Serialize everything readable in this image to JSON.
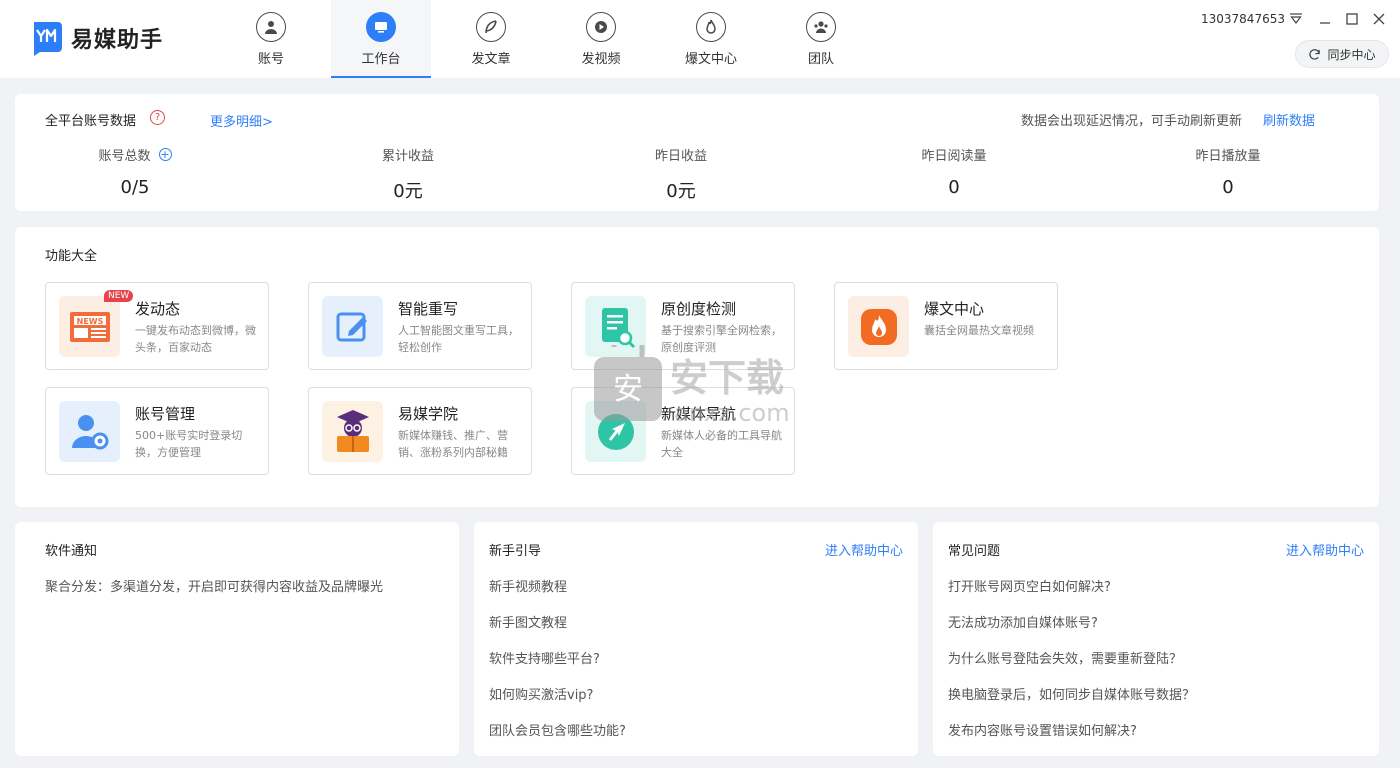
{
  "app": {
    "title": "易媒助手",
    "phone": "13037847653",
    "sync_label": "同步中心"
  },
  "nav": [
    {
      "label": "账号",
      "icon": "user-icon",
      "active": false
    },
    {
      "label": "工作台",
      "icon": "monitor-icon",
      "active": true
    },
    {
      "label": "发文章",
      "icon": "feather-icon",
      "active": false
    },
    {
      "label": "发视频",
      "icon": "play-icon",
      "active": false
    },
    {
      "label": "爆文中心",
      "icon": "fire-icon",
      "active": false
    },
    {
      "label": "团队",
      "icon": "team-icon",
      "active": false
    }
  ],
  "stats": {
    "title": "全平台账号数据",
    "more": "更多明细>",
    "delay_note": "数据会出现延迟情况，可手动刷新更新",
    "refresh": "刷新数据",
    "items": [
      {
        "label": "账号总数",
        "value": "0/5"
      },
      {
        "label": "累计收益",
        "value": "0元"
      },
      {
        "label": "昨日收益",
        "value": "0元"
      },
      {
        "label": "昨日阅读量",
        "value": "0"
      },
      {
        "label": "昨日播放量",
        "value": "0"
      }
    ]
  },
  "features": {
    "title": "功能大全",
    "badge": "NEW",
    "icon_text": "NEWS",
    "items": [
      {
        "name": "发动态",
        "desc": "一键发布动态到微博，微头条，百家动态",
        "icon": "news-icon",
        "color": "#fdeee4"
      },
      {
        "name": "智能重写",
        "desc": "人工智能图文重写工具，轻松创作",
        "icon": "edit-icon",
        "color": "#e6f0fd"
      },
      {
        "name": "原创度检测",
        "desc": "基于搜索引擎全网检索，原创度评测",
        "icon": "document-search-icon",
        "color": "#e2f6f3"
      },
      {
        "name": "爆文中心",
        "desc": "囊括全网最热文章视频",
        "icon": "fire-icon",
        "color": "#fdeee4"
      },
      {
        "name": "账号管理",
        "desc": "500+账号实时登录切换，方便管理",
        "icon": "account-settings-icon",
        "color": "#e6f0fd"
      },
      {
        "name": "易媒学院",
        "desc": "新媒体赚钱、推广、营销、涨粉系列内部秘籍",
        "icon": "scholar-icon",
        "color": "#fdf1e4"
      },
      {
        "name": "新媒体导航",
        "desc": "新媒体人必备的工具导航大全",
        "icon": "navigation-icon",
        "color": "#e2f6f3"
      }
    ]
  },
  "notice": {
    "title": "软件通知",
    "text": "聚合分发：多渠道分发，开启即可获得内容收益及品牌曝光"
  },
  "guide": {
    "title": "新手引导",
    "link": "进入帮助中心",
    "items": [
      "新手视频教程",
      "新手图文教程",
      "软件支持哪些平台?",
      "如何购买激活vip?",
      "团队会员包含哪些功能?"
    ]
  },
  "faq": {
    "title": "常见问题",
    "link": "进入帮助中心",
    "items": [
      "打开账号网页空白如何解决?",
      "无法成功添加自媒体账号?",
      "为什么账号登陆会失效，需要重新登陆？",
      "换电脑登录后，如何同步自媒体账号数据？",
      "发布内容账号设置错误如何解决?"
    ]
  },
  "watermark": {
    "glyph": "安",
    "text": "安下载",
    "sub": "anxz.com"
  }
}
